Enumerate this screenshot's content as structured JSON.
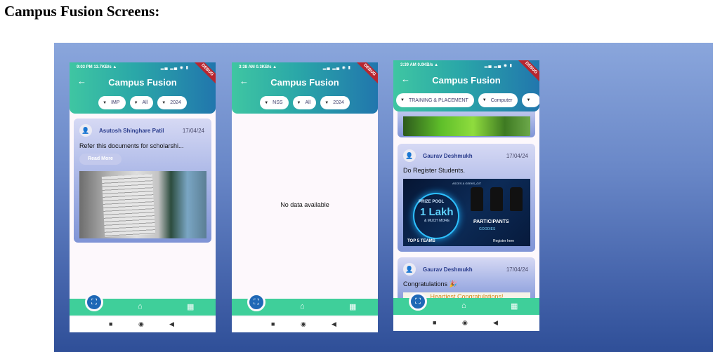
{
  "doc": {
    "title": "Campus Fusion Screens:"
  },
  "common": {
    "app_title": "Campus Fusion",
    "back_icon": "back-arrow-icon",
    "debug_ribbon": "DEBUG",
    "nav_icons": [
      "qr-scan-icon",
      "home-icon",
      "dashboard-icon"
    ],
    "sys_icons": [
      "recent-square-icon",
      "home-circle-icon",
      "back-triangle-icon"
    ]
  },
  "phone1": {
    "status_time": "9:03 PM  13.7KB/s ▲",
    "status_right": "▂▄ ▂▄ ◉ ▮",
    "chips": [
      "IMP",
      "All",
      "2024"
    ],
    "post": {
      "author": "Asutosh Shinghare Patil",
      "date": "17/04/24",
      "text": "Refer this documents for scholarshi...",
      "read_more": "Read More"
    }
  },
  "phone2": {
    "status_time": "3:38 AM  0.3KB/s ▲",
    "status_right": "▂▄ ▂▄ ◉ ▮",
    "chips": [
      "NSS",
      "All",
      "2024"
    ],
    "empty_text": "No data available"
  },
  "phone3": {
    "status_time": "3:39 AM  0.0KB/s ▲",
    "status_right": "▂▄ ▂▄ ◉ ▮",
    "chips": [
      "TRAINING & PLACEMENT",
      "Computer",
      ""
    ],
    "posts": [
      {
        "author": "Gaurav Deshmukh",
        "date": "17/04/24",
        "text": "Do Register Students.",
        "banner": {
          "top": "ASCES & GEEKS_GIT",
          "prize": "PRIZE POOL",
          "amount": "1 Lakh",
          "more": "& MUCH MORE",
          "participants": "PARTICIPANTS",
          "goodies": "GOODIES",
          "teams": "TOP 5 TEAMS",
          "register": "Register here"
        }
      },
      {
        "author": "Gaurav Deshmukh",
        "date": "17/04/24",
        "text": "Congratulations 🎉",
        "image_text": "Heartiest Congratulations!"
      }
    ]
  }
}
